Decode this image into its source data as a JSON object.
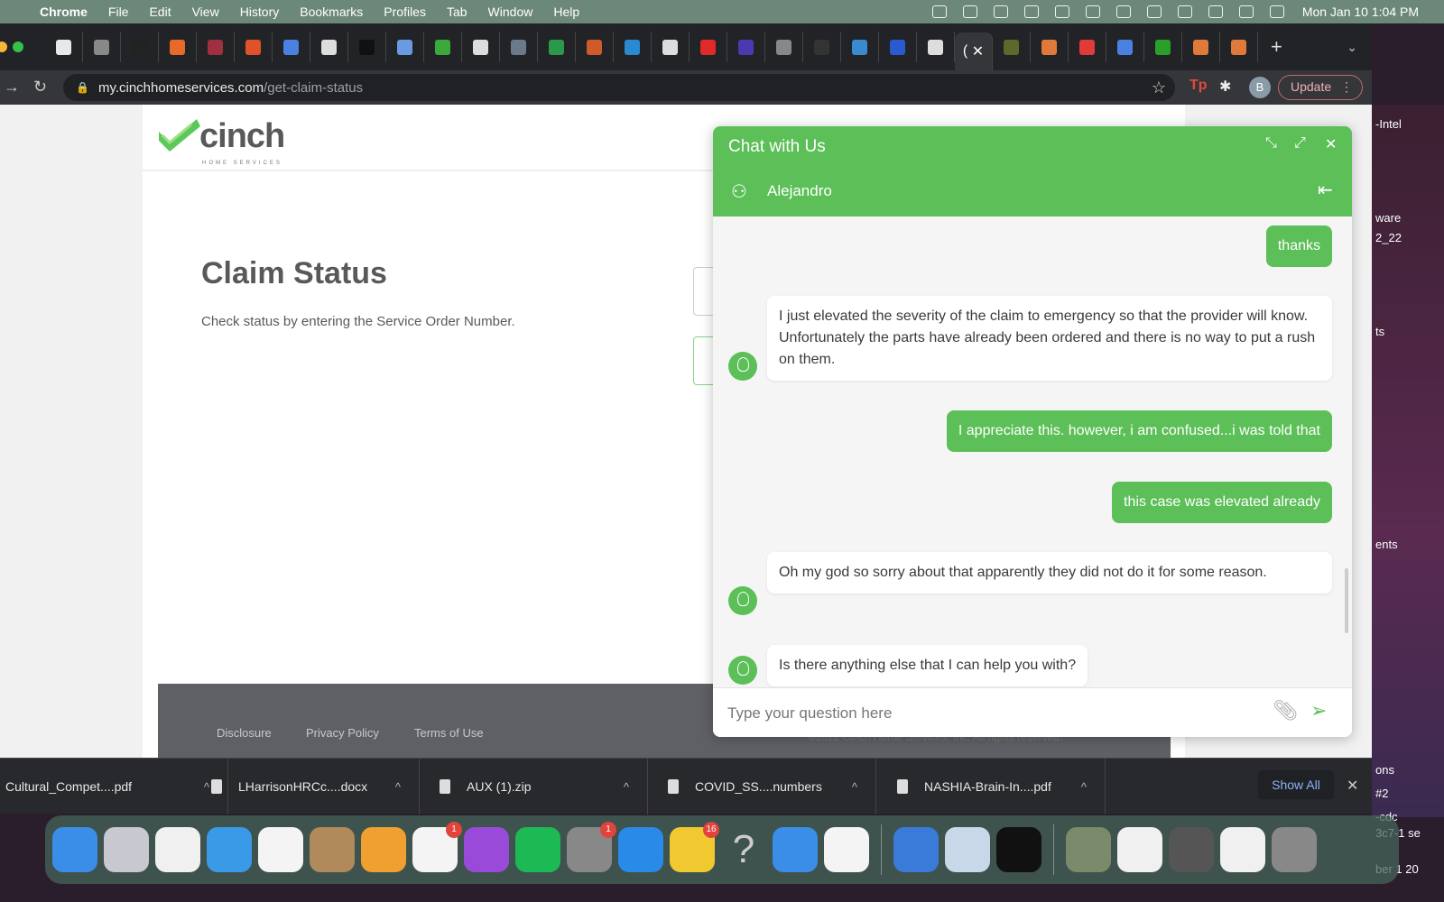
{
  "menubar": {
    "app": "Chrome",
    "items": [
      "File",
      "Edit",
      "View",
      "History",
      "Bookmarks",
      "Profiles",
      "Tab",
      "Window",
      "Help"
    ],
    "clock": "Mon Jan 10  1:04 PM",
    "status_icons": [
      "todo-icon",
      "creative-cloud-icon",
      "bi-icon",
      "window-icon",
      "play-icon",
      "keyboard-icon",
      "bluetooth-icon",
      "battery-icon",
      "wifi-icon",
      "search-icon",
      "control-center-icon",
      "siri-icon"
    ]
  },
  "tabs": {
    "favicons": [
      "#e8e8e8",
      "#888",
      "#222",
      "#e86a2a",
      "#a03040",
      "#e0522a",
      "#4a80e0",
      "#ddd",
      "#111",
      "#6a9ae0",
      "#3aa83a",
      "#ddd",
      "#6a7a8a",
      "#2a9a4a",
      "#d05a2a",
      "#2a8ad0",
      "#ddd",
      "#e02a2a",
      "#4a3ab0",
      "#888",
      "#333",
      "#3a8ad0",
      "#2a5ad0",
      "#ddd"
    ],
    "active_label": "(",
    "after_active": [
      "#5a6a2a",
      "#e07a3a",
      "#e03a3a",
      "#4a80e0",
      "#2aa02a",
      "#e07a3a",
      "#e07a3a"
    ]
  },
  "address": {
    "domain": "my.cinchhomeservices.com",
    "path": "/get-claim-status",
    "profile_initial": "B",
    "update_label": "Update"
  },
  "page": {
    "logo_text": "cinch",
    "logo_sub": "HOME SERVICES",
    "title": "Claim Status",
    "subtitle": "Check status by entering the Service Order Number.",
    "footer_links": [
      "Disclosure",
      "Privacy Policy",
      "Terms of Use"
    ],
    "copyright": "©2022 Cinch Home Services, Inc. All rights reserved."
  },
  "chat": {
    "title": "Chat with Us",
    "agent": "Alejandro",
    "messages": [
      {
        "from": "user",
        "text": "thanks"
      },
      {
        "from": "agent",
        "text": "I just elevated the severity of the claim to emergency so that the provider will know. Unfortunately the parts have already been ordered and there is no way to put a rush on them."
      },
      {
        "from": "user",
        "text": "I appreciate this. however, i am confused...i was told that"
      },
      {
        "from": "user",
        "text": "this case was elevated already"
      },
      {
        "from": "agent",
        "text": "Oh my god so sorry about that apparently they did not do it for some reason."
      },
      {
        "from": "agent",
        "text": "Is there anything else that I can help you with?"
      }
    ],
    "input_placeholder": "Type your question here"
  },
  "downloads": {
    "items": [
      "Cultural_Compet....pdf",
      "LHarrisonHRCc....docx",
      "AUX (1).zip",
      "COVID_SS....numbers",
      "NASHIA-Brain-In....pdf"
    ],
    "show_all": "Show All"
  },
  "desktop_labels": [
    "-Intel",
    "ware",
    "2_22",
    "ts",
    "ents",
    "ons",
    "#2",
    "-cdc",
    "3c7-1 se",
    "ber 1 20"
  ],
  "dock": {
    "apps": [
      {
        "name": "finder",
        "color": "#3a8ee8"
      },
      {
        "name": "launchpad",
        "color": "#c8c8d0"
      },
      {
        "name": "chrome",
        "color": "#f0f0f0"
      },
      {
        "name": "safari",
        "color": "#3a9ae8"
      },
      {
        "name": "photos",
        "color": "#f4f4f4"
      },
      {
        "name": "contacts",
        "color": "#b08a5a"
      },
      {
        "name": "pages",
        "color": "#f0a030"
      },
      {
        "name": "reminders",
        "color": "#f4f4f4",
        "badge": "1"
      },
      {
        "name": "podcasts",
        "color": "#9a4ad8"
      },
      {
        "name": "spotify",
        "color": "#1db954"
      },
      {
        "name": "system-preferences",
        "color": "#888",
        "badge": "1"
      },
      {
        "name": "app-store",
        "color": "#2a8ae8"
      },
      {
        "name": "stickies",
        "color": "#f0c830",
        "badge": "16"
      },
      {
        "name": "help",
        "color": "transparent"
      },
      {
        "name": "finder-2",
        "color": "#3a8ee8"
      },
      {
        "name": "teams",
        "color": "#f4f4f4"
      },
      {
        "name": "network",
        "color": "#3a7ad8"
      },
      {
        "name": "preview",
        "color": "#c8d8e8"
      },
      {
        "name": "terminal",
        "color": "#111"
      },
      {
        "name": "doc-1",
        "color": "#7a8a6a"
      },
      {
        "name": "doc-2",
        "color": "#f0f0f0"
      },
      {
        "name": "complaints-board",
        "color": "#555"
      },
      {
        "name": "doc-3",
        "color": "#f0f0f0"
      },
      {
        "name": "trash",
        "color": "#888"
      }
    ]
  }
}
